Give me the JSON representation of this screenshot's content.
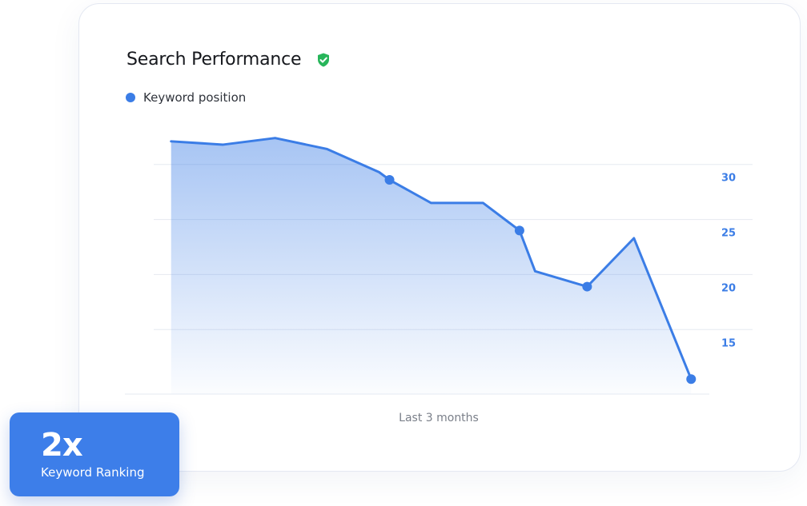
{
  "card": {
    "title": "Search Performance",
    "title_icon": "shield-check-icon",
    "legend_label": "Keyword position"
  },
  "badge": {
    "value": "2x",
    "label": "Keyword Ranking"
  },
  "colors": {
    "accent": "#3b7de6",
    "shield": "#27b55a",
    "badge_bg": "#3d7ee9",
    "axis_text": "#3b7de6",
    "grid": "#e6eaf1"
  },
  "chart_data": {
    "type": "area",
    "title": "Search Performance",
    "xlabel": "Last 3 months",
    "ylabel": "",
    "y_axis_position": "right",
    "y_inverted": true,
    "yticks": [
      15,
      20,
      25,
      30
    ],
    "ylim": [
      35.5,
      9.5
    ],
    "grid": true,
    "legend": "top-left",
    "series": [
      {
        "name": "Keyword position",
        "x": [
          0,
          1,
          2,
          3,
          4,
          4.2,
          5,
          6,
          6.7,
          7,
          8,
          8.9,
          10
        ],
        "values": [
          32.1,
          31.8,
          32.4,
          31.4,
          29.3,
          28.6,
          26.5,
          26.5,
          24.0,
          20.3,
          18.9,
          23.3,
          10.5
        ],
        "markers": [
          5,
          8,
          10,
          12
        ]
      }
    ],
    "xlim": [
      -0.15,
      10.35
    ]
  }
}
